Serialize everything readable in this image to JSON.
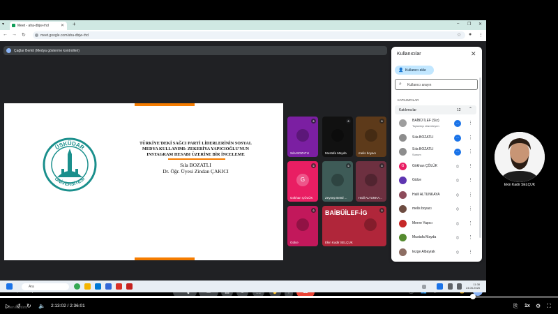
{
  "browser": {
    "tab_title": "Meet - aha-dbjw-rhd",
    "url": "meet.google.com/aha-dbjw-rhd"
  },
  "meet": {
    "presenter_banner": "Çağlar Berkit (Medya gösterme kontrolleri)",
    "meeting_code": "aha-dbjw-rhd",
    "time": "11:38"
  },
  "slide": {
    "title": "TÜRKİYE'DEKİ SAĞCI PARTİ LİDERLERİNİN SOSYAL MEDYA KULLANIMI: ZEKERİYA YAPICIOĞLU'NUN INSTAGRAM HESABI ÜZERİNE BİR İNCELEME",
    "author1": "Sıla BOZATLI",
    "author2": "Dr. Öğr. Üyesi Zindan ÇAKICI",
    "logo_text_top": "ÜSKÜDAR",
    "logo_text_bottom": "ÜNİVERSİTESİ"
  },
  "tiles": [
    {
      "name": "Sıla BOZATLI",
      "color": "#7b1fa2"
    },
    {
      "name": "Mustafa Mayda",
      "color": "#111111"
    },
    {
      "name": "melis boyacı",
      "color": "#5d3a1a"
    },
    {
      "name": "Gökhan ÇÖLÜK",
      "color": "#e91e63",
      "initial": "G"
    },
    {
      "name": "Zeynep Betül ...",
      "color": "#3e5b57"
    },
    {
      "name": "Halil ALTUNKA...",
      "color": "#6d3040"
    },
    {
      "name": "Gülce",
      "color": "#c2185b"
    },
    {
      "name": "Ekin Kadir SELÇUK",
      "color": "#b0263a",
      "banner": "BAİBÜİLEF-İG"
    }
  ],
  "people_panel": {
    "title": "Kullanıcılar",
    "add_button": "Kullanıcı ekle",
    "search_placeholder": "Kullanıcı arayın",
    "section": "KATILIMCILAR",
    "group_label": "Katılımcılar",
    "group_count": "12",
    "participants": [
      {
        "name": "BAİBÜ İLEF (Siz)",
        "sub": "Toplantıyı düzenleyen",
        "color": "#9e9e9e"
      },
      {
        "name": "Sıla BOZATLI",
        "color": "#8d8d8d"
      },
      {
        "name": "Sıla BOZATLI",
        "sub": "Sunum",
        "color": "#8d8d8d"
      },
      {
        "name": "Gökhan ÇÖLÜK",
        "color": "#e91e63",
        "initial": "G"
      },
      {
        "name": "Gülce",
        "color": "#5e35b1"
      },
      {
        "name": "Halil ALTUNKAYA",
        "color": "#8d4b5b"
      },
      {
        "name": "melis boyacı",
        "color": "#6d4c41"
      },
      {
        "name": "Merve Yapıcı",
        "color": "#c62828"
      },
      {
        "name": "Mustafa Mayda",
        "color": "#558b2f"
      },
      {
        "name": "tezge Albayrak",
        "color": "#8d6e63"
      }
    ]
  },
  "windows_taskbar": {
    "search": "Ara",
    "time": "11:38",
    "date": "24.05.2025"
  },
  "webcam": {
    "label": "Ekin Kadir SELÇUK"
  },
  "player": {
    "time": "2:13:02 / 2:36:01",
    "progress": 0.8475,
    "speed": "1x",
    "watermark": "Creen kaydımı"
  }
}
